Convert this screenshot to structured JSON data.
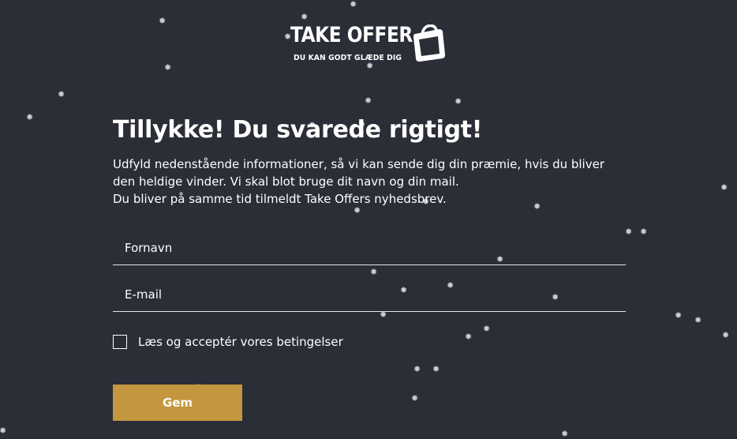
{
  "logo": {
    "name": "TAKE OFFER",
    "tagline": "DU KAN GODT GLÆDE DIG"
  },
  "headline": "Tillykke! Du svarede rigtigt!",
  "intro": {
    "line1": "Udfyld nedenstående informationer, så vi kan sende dig din præmie, hvis du bliver den heldige vinder. Vi skal blot bruge dit navn og din mail.",
    "line2": "Du bliver på samme tid tilmeldt Take Offers nyhedsbrev."
  },
  "form": {
    "first_name_placeholder": "Fornavn",
    "email_placeholder": "E-mail",
    "terms_label": "Læs og acceptér vores betingelser",
    "terms_checked": false,
    "submit_label": "Gem"
  },
  "colors": {
    "background": "#2b2e37",
    "button": "#c4963f",
    "text": "#ffffff",
    "snow": "#c9ccd3"
  },
  "icons": {
    "logo_mark": "shopping-bag-icon",
    "snowflake": "snowflake-icon"
  }
}
